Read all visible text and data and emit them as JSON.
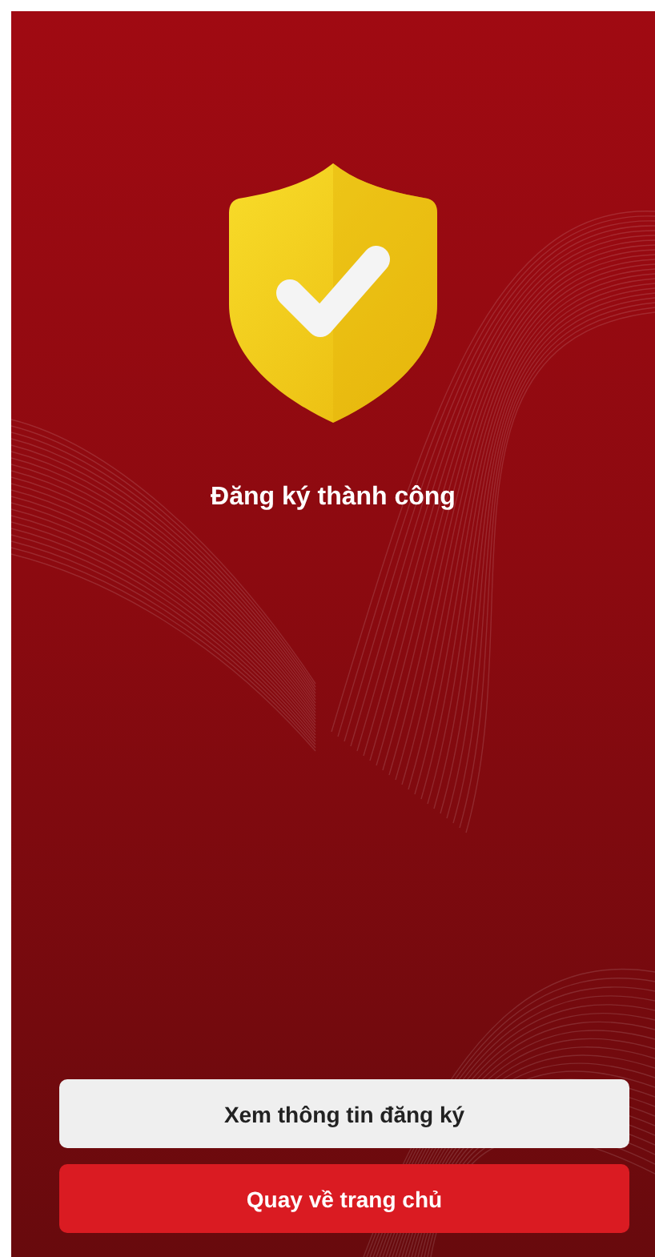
{
  "message": {
    "title": "Đăng ký thành công"
  },
  "buttons": [
    {
      "label": "Xem thông tin đăng ký",
      "kind": "secondary"
    },
    {
      "label": "Quay về trang chủ",
      "kind": "primary"
    }
  ]
}
